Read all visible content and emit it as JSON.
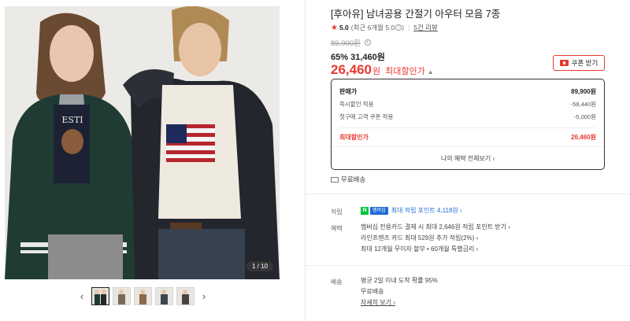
{
  "gallery": {
    "counter": "1 / 10",
    "prev_arrow": "‹",
    "next_arrow": "›"
  },
  "product": {
    "title": "[후아유] 남녀공용 간절기 아우터 모음 7종",
    "rating": {
      "star": "★",
      "value": "5.0",
      "recent": "(최근 6개월 5.0",
      "recent_close": ")",
      "reviews": "5건 리뷰"
    },
    "original_price": "89,900원",
    "discount_rate": "65%",
    "discount_price": "31,460원",
    "max_price": "26,460",
    "max_price_won": "원",
    "max_label": "최대할인가",
    "coupon_button": "쿠폰 받기"
  },
  "breakdown": {
    "rows": [
      {
        "label": "판매가",
        "value": "89,900원"
      },
      {
        "label": "즉시할인 적용",
        "value": "-58,440원"
      },
      {
        "label": "첫구매 고객 쿠폰 적용",
        "value": "-5,000원"
      },
      {
        "label": "최대할인가",
        "value": "26,460원"
      }
    ],
    "benefits_link": "나의 혜택 전체보기 ›"
  },
  "free_shipping": "무료배송",
  "points": {
    "label": "적립",
    "npay_n": "N",
    "npay_m": "멤버십",
    "text": "최대 적립 포인트 4,118원 ›"
  },
  "benefits": {
    "label": "혜택",
    "lines": [
      "멤버십 전용카드 결제 시 최대 2,646원 적립 포인트 받기 ›",
      "라인프렌즈 카드 최대 529원 추가 적립(2%) ›",
      "최대 12개월 무이자 할부 • 60개월 특별금리 ›"
    ]
  },
  "delivery": {
    "label": "배송",
    "line1": "평균 2일 이내 도착 확률 95%",
    "line2": "무료배송",
    "detail_link": "자세히 보기 ›"
  }
}
